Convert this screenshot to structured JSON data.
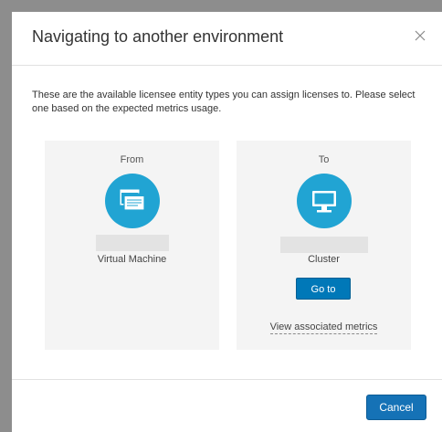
{
  "dialog": {
    "title": "Navigating to another environment",
    "close_icon": "close-icon",
    "description": "These are the available licensee entity types you can assign licenses to. Please select one based on the expected metrics usage."
  },
  "from_card": {
    "label": "From",
    "icon": "virtual-machine-icon",
    "entity_type": "Virtual Machine"
  },
  "to_card": {
    "label": "To",
    "icon": "monitor-icon",
    "entity_type": "Cluster",
    "goto_label": "Go to",
    "view_metrics_label": "View associated metrics"
  },
  "footer": {
    "cancel_label": "Cancel"
  },
  "colors": {
    "accent": "#21a4d3",
    "primary_button": "#1572b6",
    "card_background": "#f4f4f4"
  }
}
